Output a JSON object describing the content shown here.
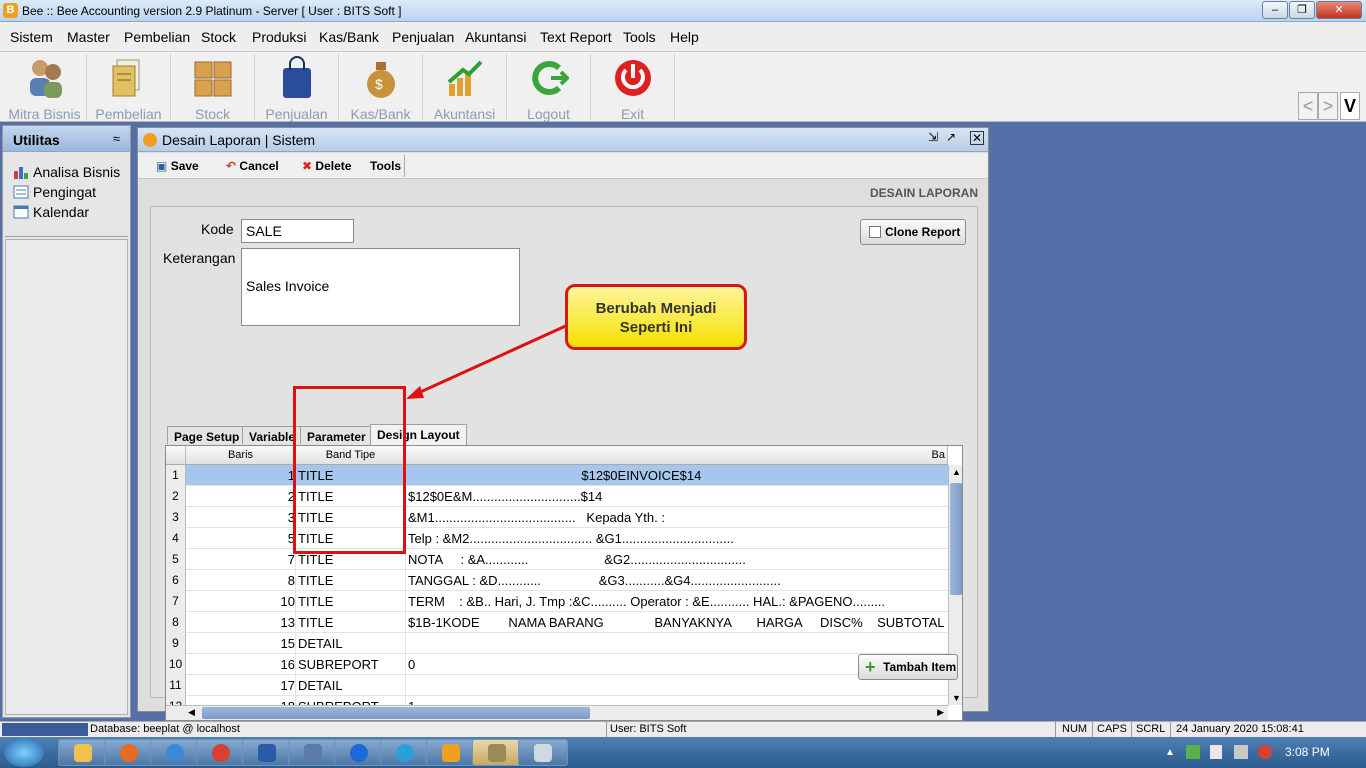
{
  "window": {
    "title": "Bee :: Bee Accounting version 2.9 Platinum - Server  [ User : BITS Soft ]",
    "app_icon": "bee-icon"
  },
  "menu": [
    "Sistem",
    "Master",
    "Pembelian",
    "Stock",
    "Produksi",
    "Kas/Bank",
    "Penjualan",
    "Akuntansi",
    "Text Report",
    "Tools",
    "Help"
  ],
  "toolbar": {
    "buttons": [
      {
        "label": "Mitra Bisnis",
        "icon": "people-icon"
      },
      {
        "label": "Pembelian",
        "icon": "purchase-icon"
      },
      {
        "label": "Stock",
        "icon": "boxes-icon"
      },
      {
        "label": "Penjualan",
        "icon": "shopping-bag-icon"
      },
      {
        "label": "Kas/Bank",
        "icon": "money-bag-icon"
      },
      {
        "label": "Akuntansi",
        "icon": "growth-chart-icon"
      },
      {
        "label": "Logout",
        "icon": "logout-icon"
      },
      {
        "label": "Exit",
        "icon": "power-icon"
      }
    ],
    "nav_prev": "<",
    "nav_next": ">",
    "logo_letter": "V"
  },
  "utilitas": {
    "title": "Utilitas",
    "collapse": "≈",
    "items": [
      {
        "label": "Analisa Bisnis",
        "icon": "bar-chart-icon"
      },
      {
        "label": "Pengingat",
        "icon": "reminder-icon"
      },
      {
        "label": "Kalendar",
        "icon": "calendar-icon"
      }
    ]
  },
  "frame": {
    "title": "Desain Laporan | Sistem",
    "actions": {
      "save": "Save",
      "cancel": "Cancel",
      "delete": "Delete",
      "tools": "Tools"
    },
    "section_label": "DESAIN LAPORAN",
    "form": {
      "kode_label": "Kode",
      "kode_value": "SALE",
      "keterangan_label": "Keterangan",
      "keterangan_value": "Sales Invoice"
    },
    "clone_button": "Clone Report",
    "tabs": [
      "Page Setup",
      "Variable",
      "Parameter",
      "Design Layout"
    ],
    "active_tab": "Design Layout",
    "grid": {
      "columns": [
        "Baris",
        "Band Tipe",
        "Ba"
      ],
      "rows": [
        {
          "n": "1",
          "baris": "1",
          "band": "TITLE",
          "value": "                                                $12$0EINVOICE$14"
        },
        {
          "n": "2",
          "baris": "2",
          "band": "TITLE",
          "value": "$12$0E&M..............................$14"
        },
        {
          "n": "3",
          "baris": "3",
          "band": "TITLE",
          "value": "&M1.......................................   Kepada Yth. :"
        },
        {
          "n": "4",
          "baris": "5",
          "band": "TITLE",
          "value": "Telp : &M2.................................. &G1..............................."
        },
        {
          "n": "5",
          "baris": "7",
          "band": "TITLE",
          "value": "NOTA     : &A............                     &G2................................"
        },
        {
          "n": "6",
          "baris": "8",
          "band": "TITLE",
          "value": "TANGGAL : &D............                &G3...........&G4........................."
        },
        {
          "n": "7",
          "baris": "10",
          "band": "TITLE",
          "value": "TERM    : &B.. Hari, J. Tmp :&C.......... Operator : &E........... HAL.: &PAGENO........."
        },
        {
          "n": "8",
          "baris": "13",
          "band": "TITLE",
          "value": "$1B-1KODE        NAMA BARANG              BANYAKNYA       HARGA     DISC%    SUBTOTAL"
        },
        {
          "n": "9",
          "baris": "15",
          "band": "DETAIL",
          "value": ""
        },
        {
          "n": "10",
          "baris": "16",
          "band": "SUBREPORT",
          "value": "0"
        },
        {
          "n": "11",
          "baris": "17",
          "band": "DETAIL",
          "value": ""
        },
        {
          "n": "12",
          "baris": "18",
          "band": "SUBREPORT",
          "value": "1"
        }
      ]
    },
    "add_button": "Tambah Item"
  },
  "callout": {
    "line1": "Berubah Menjadi",
    "line2": "Seperti Ini"
  },
  "status": {
    "database": "Database: beeplat @ localhost",
    "user": "User: BITS Soft",
    "num": "NUM",
    "caps": "CAPS",
    "scrl": "SCRL",
    "datetime": "24 January 2020  15:08:41"
  },
  "taskbar": {
    "time": "3:08 PM"
  },
  "colors": {
    "desktop": "#5570a8",
    "accent": "#e01010",
    "callout_fill": "#f5e000",
    "selected_row": "#a7c6ed"
  }
}
